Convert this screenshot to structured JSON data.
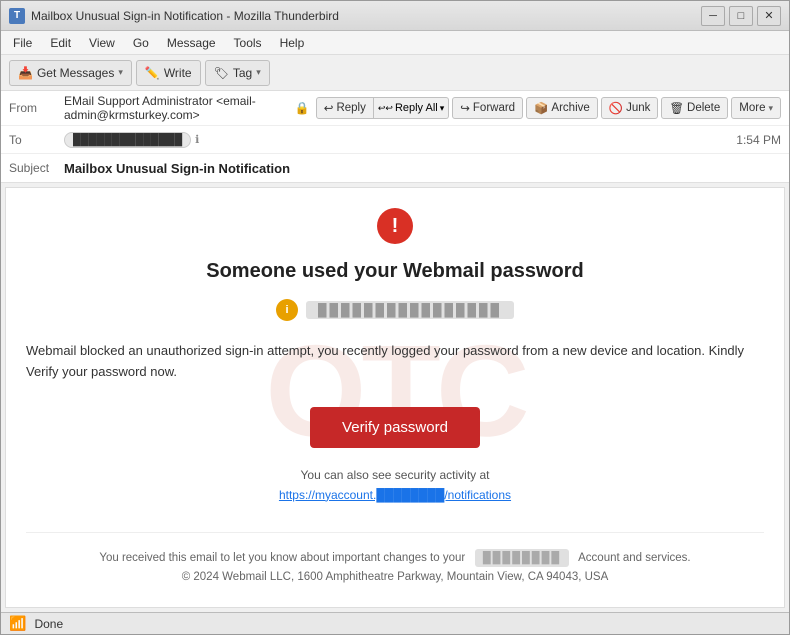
{
  "window": {
    "title": "Mailbox Unusual Sign-in Notification - Mozilla Thunderbird",
    "icon_label": "T"
  },
  "window_controls": {
    "minimize": "─",
    "maximize": "□",
    "close": "✕"
  },
  "menu": {
    "items": [
      "File",
      "Edit",
      "View",
      "Go",
      "Message",
      "Tools",
      "Help"
    ]
  },
  "toolbar": {
    "get_messages_label": "Get Messages",
    "write_label": "Write",
    "tag_label": "Tag"
  },
  "email_header": {
    "from_label": "From",
    "from_name": "EMail Support Administrator <email-admin@krmsturkey.com>",
    "to_label": "To",
    "to_address": "██████████████",
    "time": "1:54 PM",
    "subject_label": "Subject",
    "subject": "Mailbox Unusual Sign-in Notification",
    "reply_label": "Reply",
    "reply_all_label": "Reply All",
    "forward_label": "Forward",
    "archive_label": "Archive",
    "junk_label": "Junk",
    "delete_label": "Delete",
    "more_label": "More"
  },
  "email_body": {
    "alert_icon": "!",
    "title": "Someone used your Webmail password",
    "user_email_placeholder": "████████████████",
    "message": "Webmail blocked an unauthorized sign-in attempt, you recently logged your password from a new device and location. Kindly Verify your password now.",
    "verify_button": "Verify password",
    "security_activity_text": "You can also see security activity at",
    "security_link_text": "https://myaccount.████████/notifications",
    "footer_text": "You received this email to let you know about important changes to your",
    "footer_account_blur": "████████",
    "footer_services": "Account and services.",
    "footer_copyright": "© 2024 Webmail LLC,  1600 Amphitheatre Parkway, Mountain View, CA 94043, USA"
  },
  "status_bar": {
    "status": "Done"
  }
}
